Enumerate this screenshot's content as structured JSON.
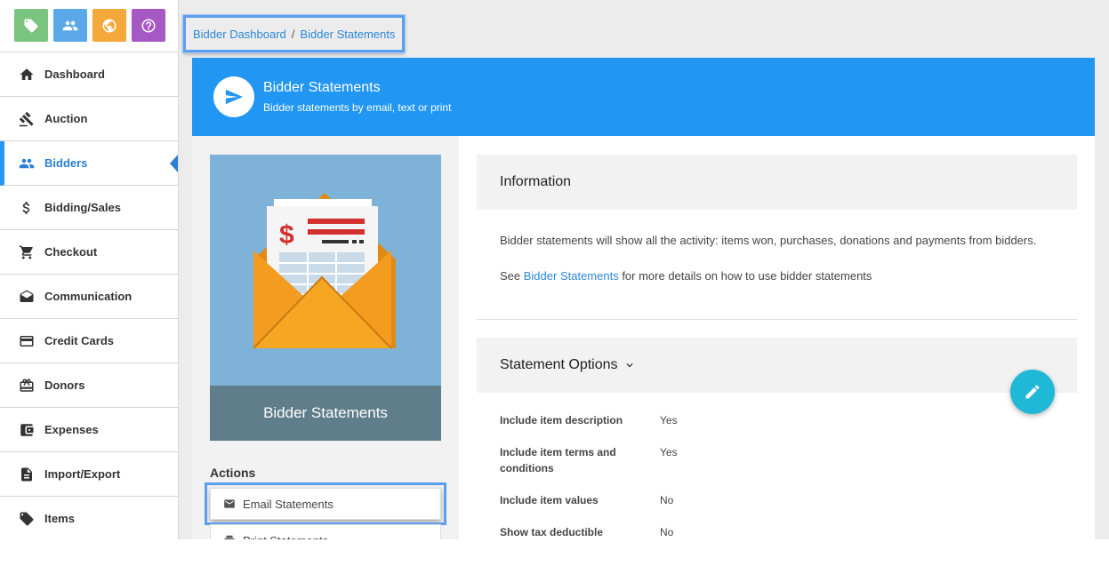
{
  "quick_buttons": [
    {
      "name": "tag-icon",
      "color": "#7bc47f"
    },
    {
      "name": "people-icon",
      "color": "#5aa8e8"
    },
    {
      "name": "globe-icon",
      "color": "#f4a93a"
    },
    {
      "name": "help-icon",
      "color": "#a659c4"
    }
  ],
  "sidebar": {
    "items": [
      {
        "label": "Dashboard",
        "icon": "home-icon"
      },
      {
        "label": "Auction",
        "icon": "gavel-icon"
      },
      {
        "label": "Bidders",
        "icon": "people-icon",
        "active": true
      },
      {
        "label": "Bidding/Sales",
        "icon": "dollar-icon"
      },
      {
        "label": "Checkout",
        "icon": "cart-icon"
      },
      {
        "label": "Communication",
        "icon": "mail-open-icon"
      },
      {
        "label": "Credit Cards",
        "icon": "credit-card-icon"
      },
      {
        "label": "Donors",
        "icon": "gift-icon"
      },
      {
        "label": "Expenses",
        "icon": "wallet-icon"
      },
      {
        "label": "Import/Export",
        "icon": "document-icon"
      },
      {
        "label": "Items",
        "icon": "tag-icon"
      }
    ]
  },
  "breadcrumb": {
    "first": "Bidder Dashboard",
    "separator": "/",
    "second": "Bidder Statements"
  },
  "banner": {
    "title": "Bidder Statements",
    "subtitle": "Bidder statements by email, text or print",
    "color": "#2196f3"
  },
  "hero": {
    "caption": "Bidder Statements"
  },
  "actions": {
    "title": "Actions",
    "email": "Email Statements",
    "print": "Print Statements"
  },
  "information": {
    "title": "Information",
    "line1": "Bidder statements will show all the activity: items won, purchases, donations and payments from bidders.",
    "line2_prefix": "See ",
    "line2_link": "Bidder Statements",
    "line2_suffix": " for more details on how to use bidder statements"
  },
  "options": {
    "title": "Statement Options",
    "rows": [
      {
        "label": "Include item description",
        "value": "Yes"
      },
      {
        "label": "Include item terms and conditions",
        "value": "Yes"
      },
      {
        "label": "Include item values",
        "value": "No"
      },
      {
        "label": "Show tax deductible",
        "value": "No"
      }
    ]
  }
}
